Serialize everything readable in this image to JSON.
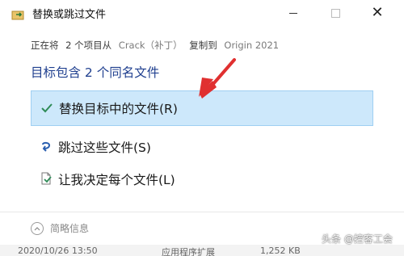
{
  "window": {
    "title": "替换或跳过文件",
    "title_icon": "file-move-icon",
    "controls": {
      "minimize_icon": "minimize-icon",
      "maximize_icon": "maximize-icon",
      "close_icon": "close-icon",
      "close_glyph": "✕"
    }
  },
  "info": {
    "prefix": "正在将",
    "count_text": "2 个项目从",
    "source": "Crack（补丁）",
    "copied_to": "复制到",
    "destination": "Origin 2021"
  },
  "heading": "目标包含 2 个同名文件",
  "options": [
    {
      "label": "替换目标中的文件(R)",
      "icon": "checkmark-icon",
      "selected": true
    },
    {
      "label": "跳过这些文件(S)",
      "icon": "skip-arrow-icon",
      "selected": false
    },
    {
      "label": "让我决定每个文件(L)",
      "icon": "document-choose-icon",
      "selected": false
    }
  ],
  "details": {
    "label": "简略信息",
    "icon": "chevron-up-icon"
  },
  "bottom_strip": {
    "date": "2020/10/26 13:50",
    "type": "应用程序扩展",
    "size": "1,252 KB"
  },
  "watermark": "头条 @控客工会",
  "colors": {
    "accent": "#1f3f8f",
    "selected_bg": "#cde8fb",
    "selected_border": "#9fcff2",
    "check": "#2e8b57",
    "arrow": "#e03030"
  }
}
